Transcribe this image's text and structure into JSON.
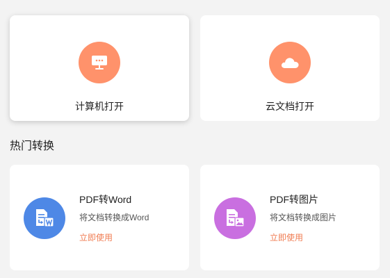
{
  "open_options": {
    "local": {
      "label": "计算机打开",
      "icon": "computer-monitor-icon",
      "color": "#ff926b"
    },
    "cloud": {
      "label": "云文档打开",
      "icon": "cloud-icon",
      "color": "#ff926b"
    }
  },
  "hot_section": {
    "title": "热门转换"
  },
  "conversions": {
    "word": {
      "title": "PDF转Word",
      "desc": "将文档转换成Word",
      "cta": "立即使用",
      "icon": "pdf-to-word-icon",
      "color": "#4e88e6"
    },
    "image": {
      "title": "PDF转图片",
      "desc": "将文档转换成图片",
      "cta": "立即使用",
      "icon": "pdf-to-image-icon",
      "color": "#c96fe0"
    }
  },
  "accent_color": "#f07c52"
}
